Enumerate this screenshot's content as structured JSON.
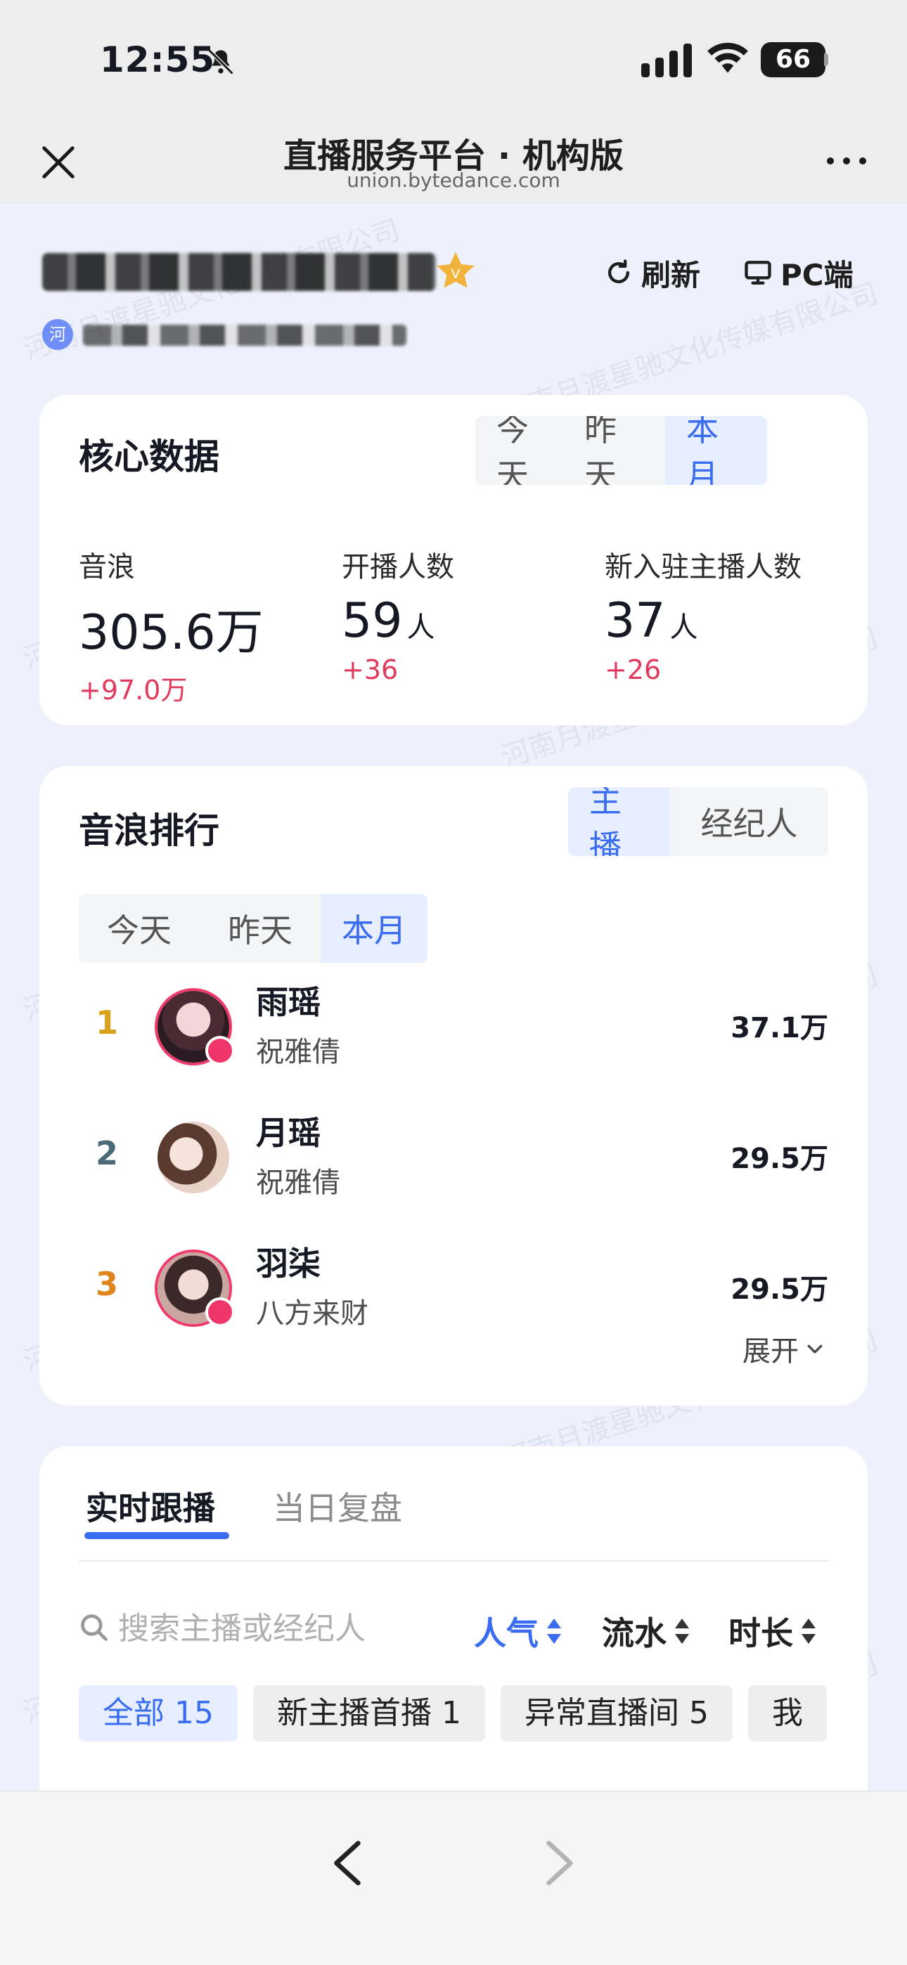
{
  "status_bar": {
    "time": "12:55",
    "battery": "66"
  },
  "nav": {
    "title": "直播服务平台 · 机构版",
    "url": "union.bytedance.com"
  },
  "header": {
    "refresh_label": "刷新",
    "pc_label": "PC端",
    "sub_icon_text": "河"
  },
  "core": {
    "title": "核心数据",
    "tabs": [
      "今天",
      "昨天",
      "本月"
    ],
    "active_tab": "本月",
    "metrics": [
      {
        "label": "音浪",
        "value": "305.6万",
        "unit": "",
        "delta": "+97.0万"
      },
      {
        "label": "开播人数",
        "value": "59",
        "unit": "人",
        "delta": "+36"
      },
      {
        "label": "新入驻主播人数",
        "value": "37",
        "unit": "人",
        "delta": "+26"
      }
    ]
  },
  "ranking": {
    "title": "音浪排行",
    "role_tabs": [
      "主播",
      "经纪人"
    ],
    "active_role": "主播",
    "period_tabs": [
      "今天",
      "昨天",
      "本月"
    ],
    "active_period": "本月",
    "rows": [
      {
        "rank": "1",
        "name": "雨瑶",
        "agent": "祝雅倩",
        "value": "37.1万",
        "rank_color": "#d9a21b",
        "live": true
      },
      {
        "rank": "2",
        "name": "月瑶",
        "agent": "祝雅倩",
        "value": "29.5万",
        "rank_color": "#4a6b78",
        "live": false
      },
      {
        "rank": "3",
        "name": "羽柒",
        "agent": "八方来财",
        "value": "29.5万",
        "rank_color": "#e0851b",
        "live": true
      }
    ],
    "expand_label": "展开"
  },
  "live": {
    "tabs": [
      "实时跟播",
      "当日复盘"
    ],
    "active_tab": "实时跟播",
    "search_placeholder": "搜索主播或经纪人",
    "sorts": [
      "人气",
      "流水",
      "时长"
    ],
    "active_sort": "人气",
    "chips": [
      "全部 15",
      "新主播首播 1",
      "异常直播间 5",
      "我"
    ]
  },
  "watermark_text": "河南月渡星驰文化传媒有限公司",
  "colors": {
    "accent": "#3a6cf0",
    "delta_red": "#e03a5c",
    "live_pink": "#f0356a"
  }
}
